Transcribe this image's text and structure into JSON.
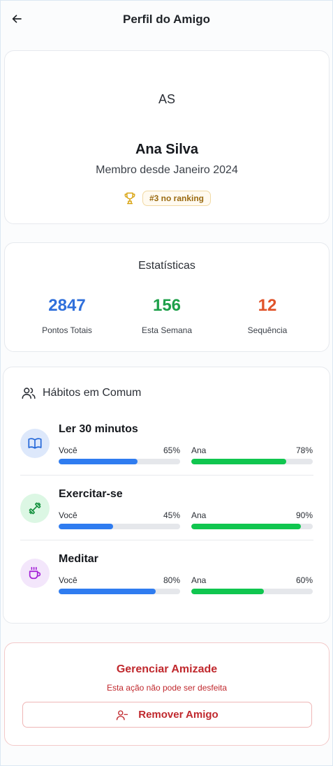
{
  "header": {
    "title": "Perfil do Amigo",
    "back_icon": "arrow-left-icon"
  },
  "profile": {
    "initials": "AS",
    "name": "Ana Silva",
    "member_since": "Membro desde Janeiro 2024",
    "rank_badge": "#3 no ranking",
    "rank_icon": "trophy-icon"
  },
  "stats": {
    "title": "Estatísticas",
    "items": [
      {
        "value": "2847",
        "label": "Pontos Totais",
        "color": "#2f6fdb"
      },
      {
        "value": "156",
        "label": "Esta Semana",
        "color": "#1ea04a"
      },
      {
        "value": "12",
        "label": "Sequência",
        "color": "#e0532a"
      }
    ]
  },
  "habits": {
    "title": "Hábitos em Comum",
    "icon": "users-icon",
    "items": [
      {
        "name": "Ler 30 minutos",
        "icon": "book-icon",
        "you_label": "Você",
        "you_pct_text": "65%",
        "you_pct": 65,
        "friend_label": "Ana",
        "friend_pct_text": "78%",
        "friend_pct": 78
      },
      {
        "name": "Exercitar-se",
        "icon": "dumbbell-icon",
        "you_label": "Você",
        "you_pct_text": "45%",
        "you_pct": 45,
        "friend_label": "Ana",
        "friend_pct_text": "90%",
        "friend_pct": 90
      },
      {
        "name": "Meditar",
        "icon": "coffee-icon",
        "you_label": "Você",
        "you_pct_text": "80%",
        "you_pct": 80,
        "friend_label": "Ana",
        "friend_pct_text": "60%",
        "friend_pct": 60
      }
    ]
  },
  "danger": {
    "title": "Gerenciar Amizade",
    "subtitle": "Esta ação não pode ser desfeita",
    "button_label": "Remover Amigo",
    "button_icon": "user-minus-icon"
  },
  "colors": {
    "you_bar": "#2f7cf0",
    "friend_bar": "#10c64f",
    "danger": "#c0282d"
  }
}
